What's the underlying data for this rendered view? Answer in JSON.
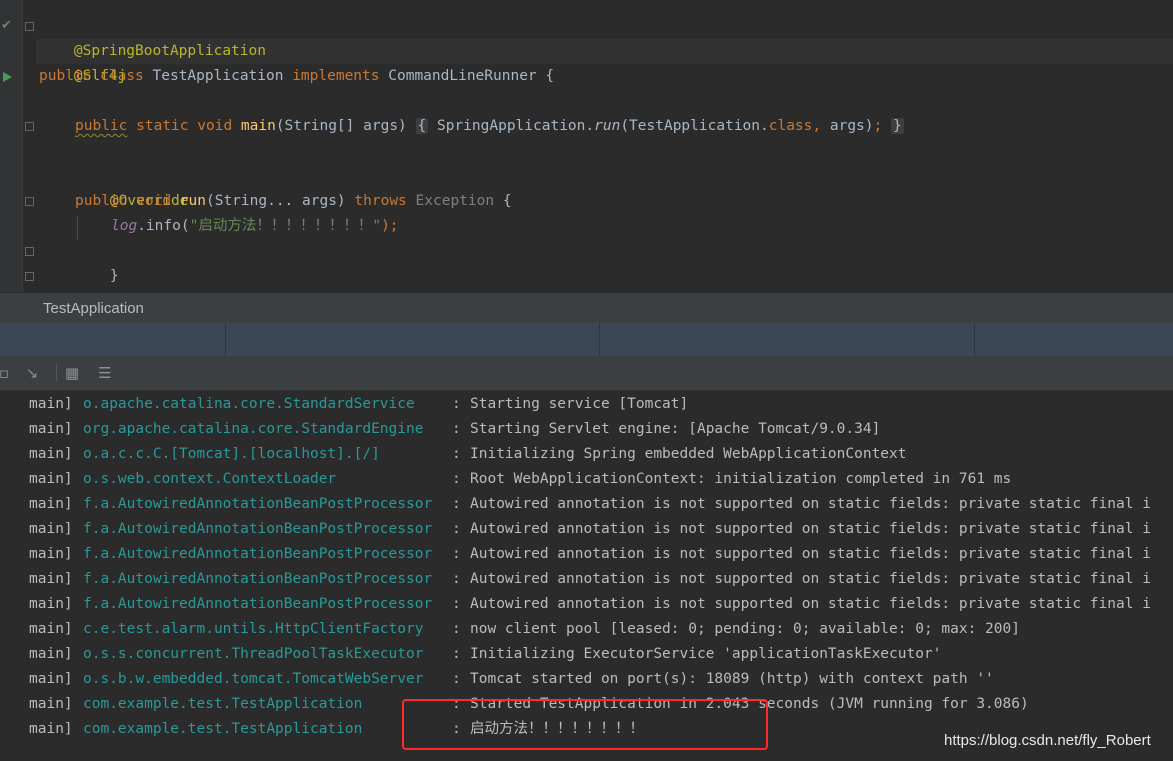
{
  "editor": {
    "l1": {
      "annotation": "@SpringBootApplication"
    },
    "l2": {
      "annotation": "@Slf4j"
    },
    "l3": {
      "kw_public": "public",
      "kw_class": "class",
      "class_name": "TestApplication",
      "kw_implements": "implements",
      "interface": "CommandLineRunner",
      "brace": "{"
    },
    "l5": {
      "kw_public": "public",
      "kw_static": "static",
      "kw_void": "void",
      "method": "main",
      "params": "(String[] args)",
      "fold_open": "{",
      "call_class": "SpringApplication.",
      "call_method": "run",
      "call_args_open": "(TestApplication.",
      "kw_class": "class",
      "comma": ",",
      "call_args_close": " args)",
      "semicolon": ";",
      "fold_close": "}"
    },
    "l7": {
      "annotation": "@Override"
    },
    "l8": {
      "kw_public": "public",
      "kw_void": "void",
      "method": "run",
      "params": "(String... args)",
      "kw_throws": "throws",
      "exception": "Exception",
      "brace": "{"
    },
    "l9": {
      "field": "log",
      "call": ".info(",
      "string": "\"启动方法！！！！！！！！\"",
      "end": ");"
    },
    "l10": {
      "brace": "}"
    },
    "l11": {
      "brace": "}"
    }
  },
  "breadcrumb": {
    "label": "TestApplication"
  },
  "toolbar": {
    "icons": [
      "stop-icon",
      "restore-layout-icon",
      "table-icon",
      "settings-icon"
    ],
    "glyphs": {
      "stop": "▫",
      "restore": "↘",
      "table": "▦",
      "settings": "☰"
    }
  },
  "console": {
    "rows": [
      {
        "thread": "main]",
        "logger": "o.apache.catalina.core.StandardService",
        "message": "Starting service [Tomcat]"
      },
      {
        "thread": "main]",
        "logger": "org.apache.catalina.core.StandardEngine",
        "message": "Starting Servlet engine: [Apache Tomcat/9.0.34]"
      },
      {
        "thread": "main]",
        "logger": "o.a.c.c.C.[Tomcat].[localhost].[/]",
        "message": "Initializing Spring embedded WebApplicationContext"
      },
      {
        "thread": "main]",
        "logger": "o.s.web.context.ContextLoader",
        "message": "Root WebApplicationContext: initialization completed in 761 ms"
      },
      {
        "thread": "main]",
        "logger": "f.a.AutowiredAnnotationBeanPostProcessor",
        "message": "Autowired annotation is not supported on static fields: private static final i"
      },
      {
        "thread": "main]",
        "logger": "f.a.AutowiredAnnotationBeanPostProcessor",
        "message": "Autowired annotation is not supported on static fields: private static final i"
      },
      {
        "thread": "main]",
        "logger": "f.a.AutowiredAnnotationBeanPostProcessor",
        "message": "Autowired annotation is not supported on static fields: private static final i"
      },
      {
        "thread": "main]",
        "logger": "f.a.AutowiredAnnotationBeanPostProcessor",
        "message": "Autowired annotation is not supported on static fields: private static final i"
      },
      {
        "thread": "main]",
        "logger": "f.a.AutowiredAnnotationBeanPostProcessor",
        "message": "Autowired annotation is not supported on static fields: private static final i"
      },
      {
        "thread": "main]",
        "logger": "c.e.test.alarm.untils.HttpClientFactory",
        "message": "now client pool [leased: 0; pending: 0; available: 0; max: 200]"
      },
      {
        "thread": "main]",
        "logger": "o.s.s.concurrent.ThreadPoolTaskExecutor",
        "message": "Initializing ExecutorService 'applicationTaskExecutor'"
      },
      {
        "thread": "main]",
        "logger": "o.s.b.w.embedded.tomcat.TomcatWebServer",
        "message": "Tomcat started on port(s): 18089 (http) with context path ''"
      },
      {
        "thread": "main]",
        "logger": "com.example.test.TestApplication",
        "message": "Started TestApplication in 2.043 seconds (JVM running for 3.086)"
      },
      {
        "thread": "main]",
        "logger": "com.example.test.TestApplication",
        "message": "启动方法！！！！！！！！"
      }
    ],
    "separator": ":"
  },
  "watermark": "https://blog.csdn.net/fly_Robert",
  "colors": {
    "keyword": "#cc7832",
    "annotation": "#bbb529",
    "method": "#ffc66d",
    "string": "#6a8759",
    "logger": "#299999",
    "highlight": "#ff2a2a"
  }
}
